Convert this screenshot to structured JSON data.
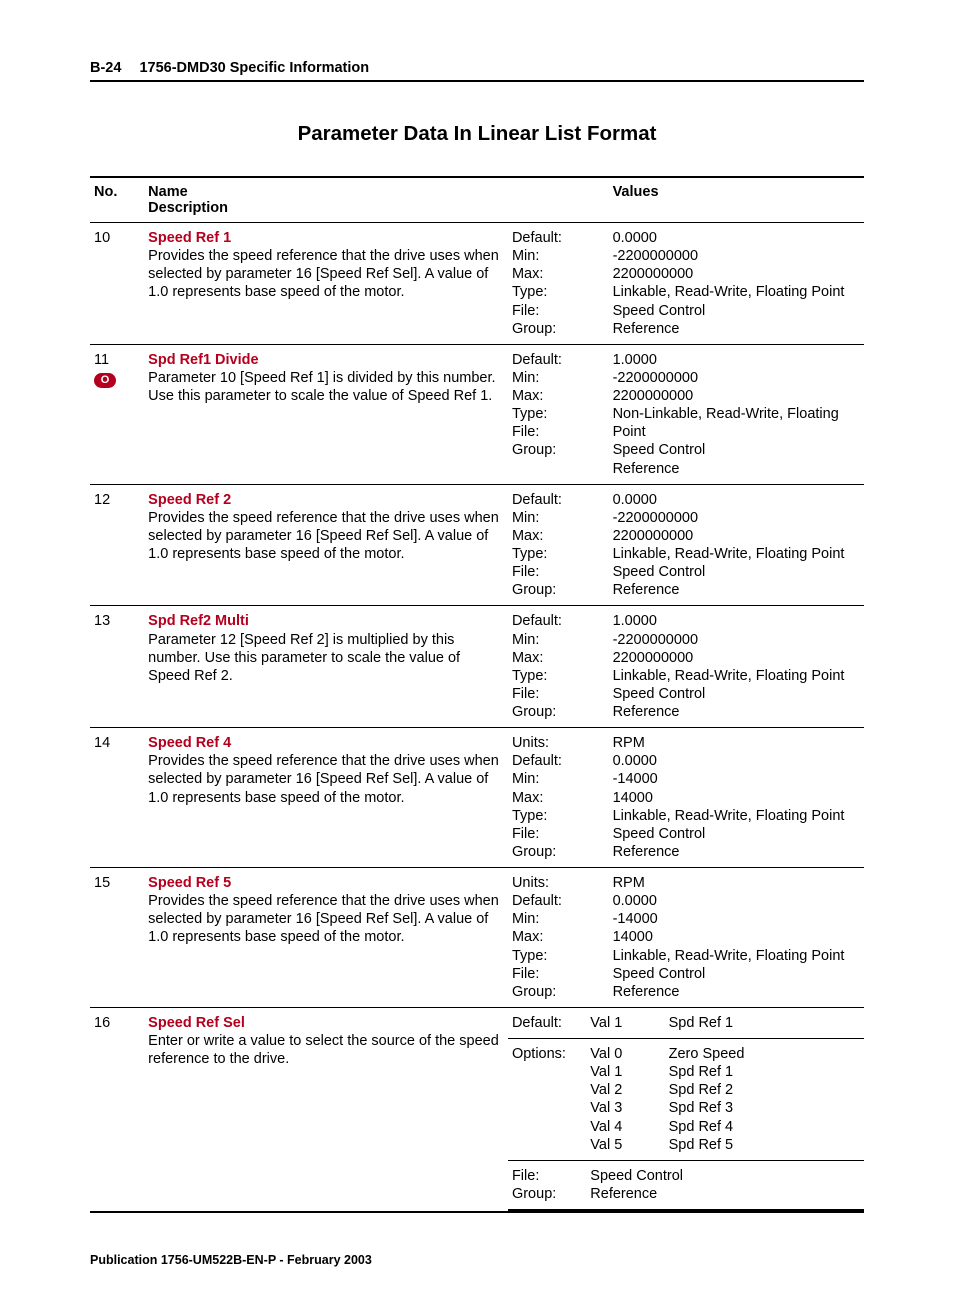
{
  "header": {
    "page_number": "B-24",
    "title": "1756-DMD30 Specific Information"
  },
  "main_title": "Parameter Data In Linear List Format",
  "columns": {
    "no": "No.",
    "name": "Name",
    "description": "Description",
    "values": "Values"
  },
  "rows": [
    {
      "no": "10",
      "icon": false,
      "name": "Speed Ref 1",
      "desc": "Provides the speed reference that the drive uses when selected by parameter 16 [Speed Ref Sel].  A value of 1.0 represents base speed of the motor.",
      "keys": "Default:\nMin:\nMax:\nType:\nFile:\nGroup:",
      "vals": "0.0000\n-2200000000\n2200000000\nLinkable, Read-Write,  Floating Point\nSpeed Control\nReference"
    },
    {
      "no": "11",
      "icon": true,
      "name": "Spd Ref1 Divide",
      "desc": "Parameter 10 [Speed Ref 1] is divided by this number.  Use this parameter to scale the value of Speed Ref 1.",
      "keys": "Default:\nMin:\nMax:\nType:\nFile:\nGroup:",
      "vals": "1.0000\n-2200000000\n2200000000\nNon-Linkable, Read-Write,  Floating Point\nSpeed Control\nReference"
    },
    {
      "no": "12",
      "icon": false,
      "name": "Speed Ref 2",
      "desc": "Provides the speed reference that the drive uses when selected by parameter 16 [Speed Ref Sel].  A value of 1.0 represents base speed of the motor.",
      "keys": "Default:\nMin:\nMax:\nType:\nFile:\nGroup:",
      "vals": "0.0000\n-2200000000\n2200000000\nLinkable, Read-Write,  Floating Point\nSpeed Control\nReference"
    },
    {
      "no": "13",
      "icon": false,
      "name": "Spd Ref2 Multi",
      "desc": "Parameter 12 [Speed Ref 2] is multiplied by this number.  Use this parameter to scale the value of Speed Ref 2.",
      "keys": "Default:\nMin:\nMax:\nType:\nFile:\nGroup:",
      "vals": "1.0000\n-2200000000\n2200000000\nLinkable, Read-Write,  Floating Point\nSpeed Control\nReference"
    },
    {
      "no": "14",
      "icon": false,
      "name": "Speed Ref 4",
      "desc": "Provides the speed reference that the drive uses when selected by parameter 16 [Speed Ref Sel].  A value of 1.0 represents base speed of the motor.",
      "keys": "Units:\nDefault:\nMin:\nMax:\nType:\nFile:\nGroup:",
      "vals": "RPM\n0.0000\n-14000\n14000\nLinkable, Read-Write,  Floating Point\nSpeed Control\nReference"
    },
    {
      "no": "15",
      "icon": false,
      "name": "Speed Ref 5",
      "desc": "Provides the speed reference that the drive uses when selected by parameter 16 [Speed Ref Sel].  A value of 1.0 represents base speed of the motor.",
      "keys": "Units:\nDefault:\nMin:\nMax:\nType:\nFile:\nGroup:",
      "vals": "RPM\n0.0000\n-14000\n14000\nLinkable, Read-Write,  Floating Point\nSpeed Control\nReference"
    }
  ],
  "row16": {
    "no": "16",
    "name": "Speed Ref Sel",
    "desc": "Enter or write a value to select the source of the speed reference to the drive.",
    "default_key": "Default:",
    "default_v1": "Val 1",
    "default_v2": "Spd Ref 1",
    "options_key": "Options:",
    "options_v1": "Val 0\nVal 1\nVal 2\nVal 3\nVal 4\nVal 5",
    "options_v2": "Zero Speed\nSpd Ref 1\nSpd Ref 2\nSpd Ref 3\nSpd Ref 4\nSpd Ref 5",
    "fg_keys": "File:\nGroup:",
    "fg_vals": "Speed Control\nReference"
  },
  "footer": "Publication 1756-UM522B-EN-P - February 2003"
}
